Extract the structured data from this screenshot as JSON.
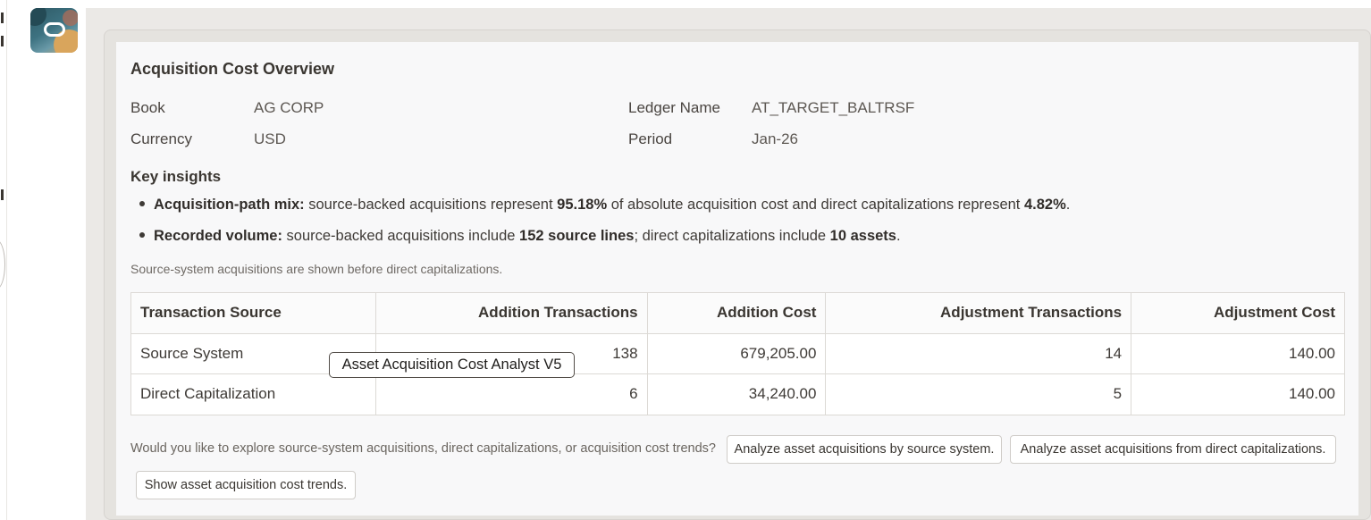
{
  "report": {
    "title": "Acquisition Cost Overview",
    "meta": {
      "book_label": "Book",
      "book_value": "AG CORP",
      "currency_label": "Currency",
      "currency_value": "USD",
      "ledger_label": "Ledger Name",
      "ledger_value": "AT_TARGET_BALTRSF",
      "period_label": "Period",
      "period_value": "Jan-26"
    },
    "insights_title": "Key insights",
    "insights": [
      {
        "lead": "Acquisition-path mix:",
        "text1": " source-backed acquisitions represent ",
        "bold1": "95.18%",
        "text2": " of absolute acquisition cost and direct capitalizations represent ",
        "bold2": "4.82%",
        "text3": "."
      },
      {
        "lead": "Recorded volume:",
        "text1": " source-backed acquisitions include ",
        "bold1": "152 source lines",
        "text2": "; direct capitalizations include ",
        "bold2": "10 assets",
        "text3": "."
      }
    ],
    "note": "Source-system acquisitions are shown before direct capitalizations.",
    "table": {
      "headers": [
        "Transaction Source",
        "Addition Transactions",
        "Addition Cost",
        "Adjustment Transactions",
        "Adjustment Cost"
      ],
      "rows": [
        [
          "Source System",
          "138",
          "679,205.00",
          "14",
          "140.00"
        ],
        [
          "Direct Capitalization",
          "6",
          "34,240.00",
          "5",
          "140.00"
        ]
      ]
    },
    "tooltip": "Asset Acquisition Cost Analyst V5",
    "followup": {
      "prompt": "Would you like to explore source-system acquisitions, direct capitalizations, or acquisition cost trends?",
      "suggestions": [
        "Analyze asset acquisitions by source system.",
        "Analyze asset acquisitions from direct capitalizations.",
        "Show asset acquisition cost trends."
      ]
    }
  }
}
